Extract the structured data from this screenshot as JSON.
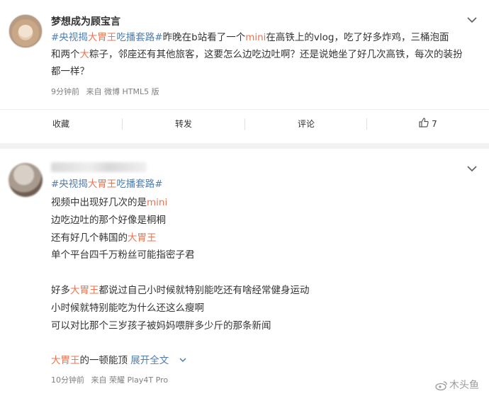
{
  "post1": {
    "username": "梦想成为顾宝言",
    "line1": [
      {
        "t": "#央视揭",
        "c": "hashtag"
      },
      {
        "t": "大胃王",
        "c": "tag"
      },
      {
        "t": "吃播套路#",
        "c": "hashtag"
      },
      {
        "t": "昨晚在b站看了一个",
        "c": "plain"
      },
      {
        "t": "mini",
        "c": "tag"
      },
      {
        "t": "在高铁上的vlog，吃了好多炸鸡，三桶泡面",
        "c": "plain"
      }
    ],
    "line2": [
      {
        "t": "和两个",
        "c": "plain"
      },
      {
        "t": "大",
        "c": "tag"
      },
      {
        "t": "粽子，邻座还有其他旅客，这要怎么边吃边吐啊？还是说她坐了好几次高铁，每次的装扮",
        "c": "plain"
      }
    ],
    "line3": "都一样？",
    "meta": {
      "time": "9分钟前",
      "source": "来自 微博 HTML5 版"
    },
    "actions": {
      "collect": "收藏",
      "repost": "转发",
      "comment": "评论",
      "likes": "7"
    }
  },
  "post2": {
    "line1": [
      {
        "t": "#央视揭",
        "c": "hashtag"
      },
      {
        "t": "大胃王",
        "c": "tag"
      },
      {
        "t": "吃播套路#",
        "c": "hashtag"
      }
    ],
    "line2": [
      {
        "t": "视频中出现好几次的是",
        "c": "plain"
      },
      {
        "t": "mini",
        "c": "tag"
      }
    ],
    "line3": "边吃边吐的那个好像是桐桐",
    "line4": [
      {
        "t": "还有好几个韩国的",
        "c": "plain"
      },
      {
        "t": "大胃王",
        "c": "tag"
      }
    ],
    "line5": "单个平台四千万粉丝可能指密子君",
    "line6": [
      {
        "t": "好多",
        "c": "plain"
      },
      {
        "t": "大胃王",
        "c": "tag"
      },
      {
        "t": "都说过自己小时候就特别能吃还有啥经常健身运动",
        "c": "plain"
      }
    ],
    "line7": "小时候就特别能吃为什么还这么瘦啊",
    "line8": "可以对比那个三岁孩子被妈妈喂胖多少斤的那条新闻",
    "line9": [
      {
        "t": "大胃王",
        "c": "tag"
      },
      {
        "t": "的一顿能顶 ",
        "c": "plain"
      },
      {
        "t": "展开全文",
        "c": "link"
      }
    ],
    "meta": {
      "time": "10分钟前",
      "source": "来自 荣耀 Play4T Pro"
    }
  },
  "watermark": "木头鱼",
  "colors": {
    "accent": "#eb7350",
    "link": "#507daf",
    "meta": "#808080"
  }
}
